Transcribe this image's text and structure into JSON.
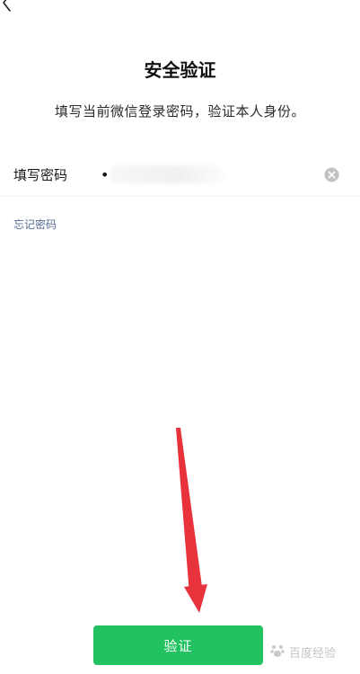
{
  "header": {
    "back_icon": "chevron-left-icon",
    "title": "安全验证",
    "subtitle": "填写当前微信登录密码，验证本人身份。"
  },
  "password_field": {
    "label": "填写密码",
    "value": "•",
    "clear_icon": "clear-circle-icon"
  },
  "forgot_password": {
    "label": "忘记密码"
  },
  "verify_button": {
    "label": "验证",
    "color": "#21c25f"
  },
  "annotation": {
    "arrow_color": "#e8323c"
  },
  "watermark": {
    "text": "百度经验"
  },
  "colors": {
    "link": "#576b95",
    "primary_green": "#21c25f"
  }
}
